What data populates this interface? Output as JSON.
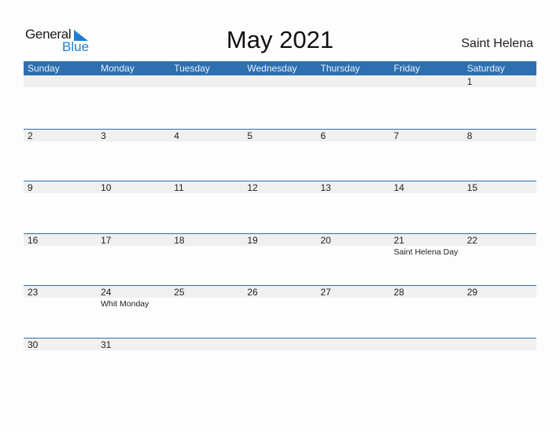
{
  "logo": {
    "word1": "General",
    "word2": "Blue"
  },
  "title": "May 2021",
  "country": "Saint Helena",
  "colors": {
    "header_bg": "#2e6fb0",
    "date_strip": "#f0f0f0",
    "logo_blue": "#1e7fd0"
  },
  "weekdays": [
    "Sunday",
    "Monday",
    "Tuesday",
    "Wednesday",
    "Thursday",
    "Friday",
    "Saturday"
  ],
  "weeks": [
    {
      "days": [
        {
          "day": "",
          "event": ""
        },
        {
          "day": "",
          "event": ""
        },
        {
          "day": "",
          "event": ""
        },
        {
          "day": "",
          "event": ""
        },
        {
          "day": "",
          "event": ""
        },
        {
          "day": "",
          "event": ""
        },
        {
          "day": "1",
          "event": ""
        }
      ]
    },
    {
      "days": [
        {
          "day": "2",
          "event": ""
        },
        {
          "day": "3",
          "event": ""
        },
        {
          "day": "4",
          "event": ""
        },
        {
          "day": "5",
          "event": ""
        },
        {
          "day": "6",
          "event": ""
        },
        {
          "day": "7",
          "event": ""
        },
        {
          "day": "8",
          "event": ""
        }
      ]
    },
    {
      "days": [
        {
          "day": "9",
          "event": ""
        },
        {
          "day": "10",
          "event": ""
        },
        {
          "day": "11",
          "event": ""
        },
        {
          "day": "12",
          "event": ""
        },
        {
          "day": "13",
          "event": ""
        },
        {
          "day": "14",
          "event": ""
        },
        {
          "day": "15",
          "event": ""
        }
      ]
    },
    {
      "days": [
        {
          "day": "16",
          "event": ""
        },
        {
          "day": "17",
          "event": ""
        },
        {
          "day": "18",
          "event": ""
        },
        {
          "day": "19",
          "event": ""
        },
        {
          "day": "20",
          "event": ""
        },
        {
          "day": "21",
          "event": "Saint Helena Day"
        },
        {
          "day": "22",
          "event": ""
        }
      ]
    },
    {
      "days": [
        {
          "day": "23",
          "event": ""
        },
        {
          "day": "24",
          "event": "Whit Monday"
        },
        {
          "day": "25",
          "event": ""
        },
        {
          "day": "26",
          "event": ""
        },
        {
          "day": "27",
          "event": ""
        },
        {
          "day": "28",
          "event": ""
        },
        {
          "day": "29",
          "event": ""
        }
      ]
    },
    {
      "days": [
        {
          "day": "30",
          "event": ""
        },
        {
          "day": "31",
          "event": ""
        },
        {
          "day": "",
          "event": ""
        },
        {
          "day": "",
          "event": ""
        },
        {
          "day": "",
          "event": ""
        },
        {
          "day": "",
          "event": ""
        },
        {
          "day": "",
          "event": ""
        }
      ]
    }
  ]
}
